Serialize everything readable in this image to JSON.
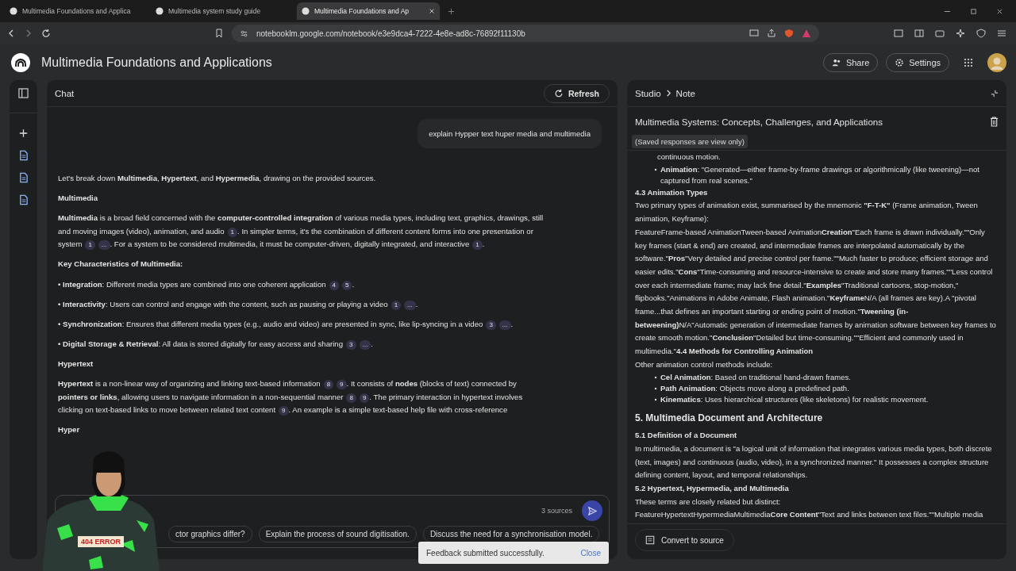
{
  "browser": {
    "tabs": [
      {
        "title": "Multimedia Foundations and Applica",
        "selected": false
      },
      {
        "title": "Multimedia system study guide",
        "selected": false
      },
      {
        "title": "Multimedia Foundations and Ap",
        "selected": true
      }
    ],
    "url": "notebooklm.google.com/notebook/e3e9dca4-7222-4e8e-ad8c-76892f11130b"
  },
  "app": {
    "title": "Multimedia Foundations and Applications",
    "share": "Share",
    "settings": "Settings"
  },
  "rail": {
    "items": [
      {
        "kind": "add"
      },
      {
        "kind": "source"
      },
      {
        "kind": "source"
      },
      {
        "kind": "source"
      }
    ]
  },
  "chat": {
    "title": "Chat",
    "refresh": "Refresh",
    "question": "explain Hypper text huper media and multimedia",
    "blocks": [
      {
        "kind": "p",
        "parts": [
          {
            "kind": "text",
            "text": "Let's break down **Multimedia**, **Hypertext**, and **Hypermedia**, drawing on the provided sources."
          }
        ]
      },
      {
        "kind": "heading",
        "parts": [
          {
            "kind": "text",
            "text": "Multimedia"
          }
        ]
      },
      {
        "kind": "p",
        "parts": [
          {
            "kind": "text",
            "text": "**Multimedia** is a broad field concerned with the **computer-controlled integration** of various media types, including text, graphics, drawings, still and moving images (video), animation, and audio"
          },
          {
            "kind": "cite",
            "text": "1"
          },
          {
            "kind": "text",
            "text": ". In simpler terms, it's the combination of different content forms into one presentation or system"
          },
          {
            "kind": "cite",
            "text": "1"
          },
          {
            "kind": "cite",
            "text": "..."
          },
          {
            "kind": "text",
            "text": ". For a system to be considered multimedia, it must be computer-driven, digitally integrated, and interactive"
          },
          {
            "kind": "cite",
            "text": "1"
          },
          {
            "kind": "text",
            "text": "."
          }
        ]
      },
      {
        "kind": "heading",
        "parts": [
          {
            "kind": "text",
            "text": "Key Characteristics of Multimedia:"
          }
        ]
      },
      {
        "kind": "p",
        "parts": [
          {
            "kind": "text",
            "text": "• **Integration**: Different media types are combined into one coherent application"
          },
          {
            "kind": "cite",
            "text": "4"
          },
          {
            "kind": "cite",
            "text": "5"
          },
          {
            "kind": "text",
            "text": "."
          }
        ]
      },
      {
        "kind": "p",
        "parts": [
          {
            "kind": "text",
            "text": "• **Interactivity**: Users can control and engage with the content, such as pausing or playing a video"
          },
          {
            "kind": "cite",
            "text": "1"
          },
          {
            "kind": "cite",
            "text": "..."
          },
          {
            "kind": "text",
            "text": "."
          }
        ]
      },
      {
        "kind": "p",
        "parts": [
          {
            "kind": "text",
            "text": "• **Synchronization**: Ensures that different media types (e.g., audio and video) are presented in sync, like lip-syncing in a video"
          },
          {
            "kind": "cite",
            "text": "3"
          },
          {
            "kind": "cite",
            "text": "..."
          },
          {
            "kind": "text",
            "text": "."
          }
        ]
      },
      {
        "kind": "p",
        "parts": [
          {
            "kind": "text",
            "text": "• **Digital Storage & Retrieval**: All data is stored digitally for easy access and sharing"
          },
          {
            "kind": "cite",
            "text": "3"
          },
          {
            "kind": "cite",
            "text": "..."
          },
          {
            "kind": "text",
            "text": "."
          }
        ]
      },
      {
        "kind": "heading",
        "parts": [
          {
            "kind": "text",
            "text": "Hypertext"
          }
        ]
      },
      {
        "kind": "p",
        "parts": [
          {
            "kind": "text",
            "text": "**Hypertext** is a non-linear way of organizing and linking text-based information"
          },
          {
            "kind": "cite",
            "text": "8"
          },
          {
            "kind": "cite",
            "text": "9"
          },
          {
            "kind": "text",
            "text": ". It consists of **nodes** (blocks of text) connected by **pointers or links**, allowing users to navigate information in a non-sequential manner"
          },
          {
            "kind": "cite",
            "text": "8"
          },
          {
            "kind": "cite",
            "text": "9"
          },
          {
            "kind": "text",
            "text": ". The primary interaction in hypertext involves clicking on text-based links to move between related text content"
          },
          {
            "kind": "cite",
            "text": "9"
          },
          {
            "kind": "text",
            "text": ". An example is a simple text-based help file with cross-reference"
          }
        ]
      },
      {
        "kind": "heading",
        "parts": [
          {
            "kind": "text",
            "text": "Hyper"
          }
        ]
      }
    ],
    "sources": "3 sources",
    "suggestions": [
      "ctor graphics differ?",
      "Explain the process of sound digitisation.",
      "Discuss the need for a synchronisation model."
    ]
  },
  "studio": {
    "breadcrumb": [
      "Studio",
      "Note"
    ],
    "note_title": "Multimedia Systems: Concepts, Challenges, and Applications",
    "view_only": "(Saved responses are view only)",
    "blocks": [
      {
        "kind": "cont",
        "text": "continuous motion."
      },
      {
        "kind": "bullet",
        "text": "**Animation**: \"Generated—either frame-by-frame drawings or algorithmically (like tweening)—not captured from real scenes.\""
      },
      {
        "kind": "h3",
        "text": "4.3 Animation Types"
      },
      {
        "kind": "p",
        "text": "Two primary types of animation exist, summarised by the mnemonic **\"F-T-K\"** (Frame animation, Tween animation, Keyframe):"
      },
      {
        "kind": "p",
        "text": "FeatureFrame-based AnimationTween-based Animation**Creation**\"Each frame is drawn individually.\"\"Only key frames (start & end) are created, and intermediate frames are interpolated automatically by the software.\"**Pros**\"Very detailed and precise control per frame.\"\"Much faster to produce; efficient storage and easier edits.\"**Cons**\"Time-consuming and resource-intensive to create and store many frames.\"\"Less control over each intermediate frame; may lack fine detail.\"**Examples**\"Traditional cartoons, stop-motion,\" flipbooks.\"Animations in Adobe Animate, Flash animation.\"**Keyframe**N/A (all frames are key).A \"pivotal frame...that defines an important starting or ending point of motion.\"**Tweening (in-betweening)**N/A\"Automatic generation of intermediate frames by animation software between key frames to create smooth motion.\"**Conclusion**\"Detailed but time-consuming.\"\"Efficient and commonly used in multimedia.\"**4.4 Methods for Controlling Animation**"
      },
      {
        "kind": "p",
        "text": "Other animation control methods include:"
      },
      {
        "kind": "bullet",
        "text": "**Cel Animation**: Based on traditional hand-drawn frames."
      },
      {
        "kind": "bullet",
        "text": "**Path Animation**: Objects move along a predefined path."
      },
      {
        "kind": "bullet",
        "text": "**Kinematics**: Uses hierarchical structures (like skeletons) for realistic movement."
      },
      {
        "kind": "h2",
        "text": "5. Multimedia Document and Architecture"
      },
      {
        "kind": "h3",
        "text": "5.1 Definition of a Document"
      },
      {
        "kind": "p",
        "text": "In multimedia, a document is \"a logical unit of information that integrates various media types, both discrete (text, images) and continuous (audio, video), in a synchronized manner.\" It possesses a complex structure defining content, layout, and temporal relationships."
      },
      {
        "kind": "h3",
        "text": "5.2 Hypertext, Hypermedia, and Multimedia"
      },
      {
        "kind": "p",
        "text": "These terms are closely related but distinct:"
      },
      {
        "kind": "p",
        "text": "FeatureHypertextHypermediaMultimedia**Core Content**\"Text and links between text files.\"\"Multiple media"
      }
    ],
    "convert": "Convert to source"
  },
  "toast": {
    "message": "Feedback submitted successfully.",
    "action": "Close"
  },
  "overlay": {
    "badge": "404 ERROR"
  }
}
